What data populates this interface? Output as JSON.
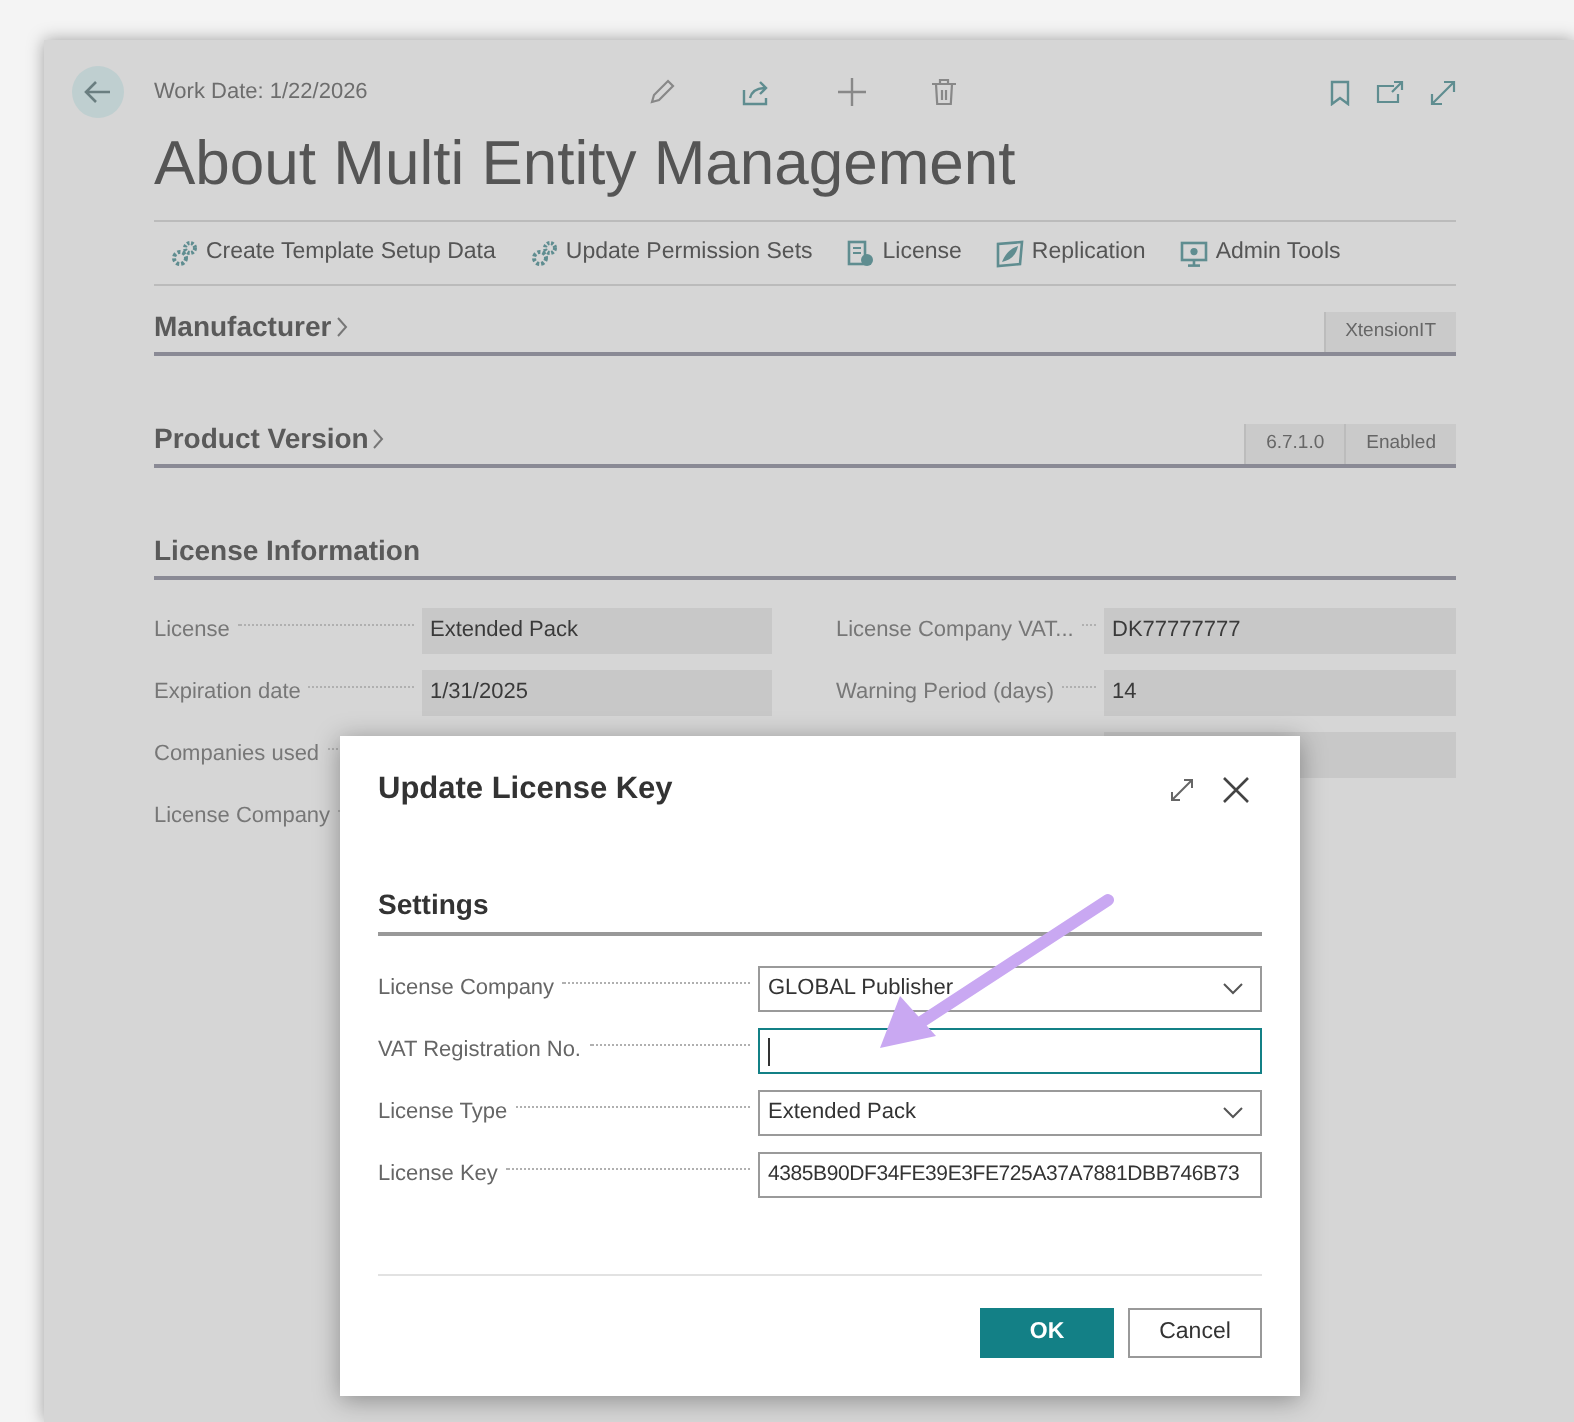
{
  "header": {
    "work_date": "Work Date: 1/22/2026"
  },
  "title": "About Multi Entity Management",
  "actions": [
    {
      "kind": "gears",
      "label": "Create Template Setup Data"
    },
    {
      "kind": "gears",
      "label": "Update Permission Sets"
    },
    {
      "kind": "license",
      "label": "License"
    },
    {
      "kind": "replication",
      "label": "Replication"
    },
    {
      "kind": "admin",
      "label": "Admin Tools"
    }
  ],
  "sections": [
    {
      "title": "Manufacturer",
      "values": [
        "XtensionIT"
      ]
    },
    {
      "title": "Product Version",
      "values": [
        "6.7.1.0",
        "Enabled"
      ]
    }
  ],
  "license_info": {
    "title": "License Information",
    "rows": [
      {
        "left": {
          "label": "License",
          "value": "Extended Pack"
        },
        "right": {
          "label": "License Company VAT...",
          "value": "DK77777777"
        }
      },
      {
        "left": {
          "label": "Expiration date",
          "value": "1/31/2025"
        },
        "right": {
          "label": "Warning Period (days)",
          "value": "14"
        }
      },
      {
        "left": {
          "label": "Companies used"
        },
        "right": {}
      },
      {
        "left": {
          "label": "License Company"
        }
      }
    ]
  },
  "dialog": {
    "title": "Update License Key",
    "section": "Settings",
    "fields": [
      {
        "kind": "select",
        "label": "License Company",
        "value": "GLOBAL Publisher",
        "focused": false
      },
      {
        "kind": "text",
        "label": "VAT Registration No.",
        "focused": true
      },
      {
        "kind": "select",
        "label": "License Type",
        "value": "Extended Pack",
        "focused": false
      },
      {
        "kind": "text",
        "label": "License Key",
        "value": "4385B90DF34FE39E3FE725A37A7881DBB746B73",
        "focused": false
      }
    ],
    "buttons": [
      {
        "label": "OK",
        "kind": "primary"
      },
      {
        "label": "Cancel",
        "kind": "secondary"
      }
    ]
  }
}
